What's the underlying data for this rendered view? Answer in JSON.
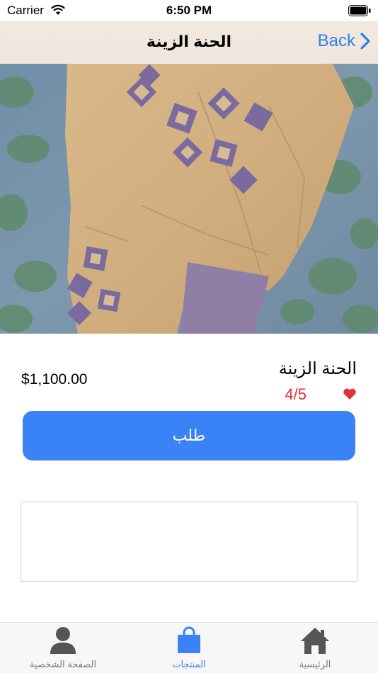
{
  "status_bar": {
    "carrier": "Carrier",
    "time": "6:50 PM",
    "wifi_icon": "wifi-icon",
    "battery_icon": "battery-icon"
  },
  "nav": {
    "title": "الحنة الزينة",
    "back_label": "Back",
    "back_icon": "chevron-right-icon"
  },
  "product": {
    "image": "product-photo",
    "name": "الحنة الزينة",
    "price": "$1,100.00",
    "rating": "4/5",
    "rating_icon": "heart-icon",
    "order_label": "طلب"
  },
  "notes_box": {
    "value": ""
  },
  "tabs": [
    {
      "label": "الصفحة الشخصية",
      "icon": "person-icon",
      "active": false
    },
    {
      "label": "المنتجات",
      "icon": "shopping-bag-icon",
      "active": true
    },
    {
      "label": "الرئيسية",
      "icon": "home-icon",
      "active": false
    }
  ],
  "colors": {
    "accent": "#3a83f6",
    "rating": "#e1323a",
    "icon_gray": "#555555",
    "link": "#2f80ed"
  }
}
